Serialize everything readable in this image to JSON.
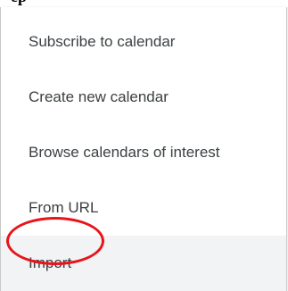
{
  "heading": "ep",
  "menu": {
    "items": [
      {
        "label": "Subscribe to calendar"
      },
      {
        "label": "Create new calendar"
      },
      {
        "label": "Browse calendars of interest"
      },
      {
        "label": "From URL"
      },
      {
        "label": "Import",
        "highlighted": true
      }
    ]
  },
  "colors": {
    "text": "#3c4043",
    "hover_background": "#f1f3f4",
    "annotation_ring": "#e8141b"
  }
}
